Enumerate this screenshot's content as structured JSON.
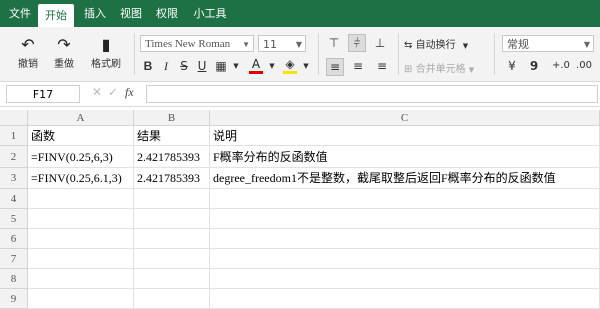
{
  "menu": {
    "items": [
      {
        "label": "文件"
      },
      {
        "label": "开始"
      },
      {
        "label": "插入"
      },
      {
        "label": "视图"
      },
      {
        "label": "权限"
      },
      {
        "label": "小工具"
      }
    ],
    "active": "开始"
  },
  "ribbon": {
    "undo_label": "撤销",
    "redo_label": "重做",
    "format_painter_label": "格式刷",
    "font_name": "Times New Roman",
    "font_size": "11",
    "wrap_label": "自动换行",
    "merge_label": "合并单元格",
    "number_format": "常规",
    "bold": "B",
    "italic": "I",
    "strike": "S",
    "underline": "U",
    "font_color_letter": "A",
    "currency": "¥",
    "comma": "9",
    "accent_color": "#1e7145",
    "font_color": "#e00000",
    "fill_color": "#f5e400"
  },
  "formula_bar": {
    "cell_ref": "F17",
    "fx": "fx",
    "content": ""
  },
  "sheet": {
    "columns": [
      "A",
      "B",
      "C"
    ],
    "rows": [
      "1",
      "2",
      "3",
      "4",
      "5",
      "6",
      "7",
      "8",
      "9"
    ],
    "cells": [
      [
        "函数",
        "结果",
        "说明"
      ],
      [
        "=FINV(0.25,6,3)",
        "2.421785393",
        "F概率分布的反函数值"
      ],
      [
        "=FINV(0.25,6.1,3)",
        "2.421785393",
        "degree_freedom1不是整数，截尾取整后返回F概率分布的反函数值"
      ]
    ]
  }
}
